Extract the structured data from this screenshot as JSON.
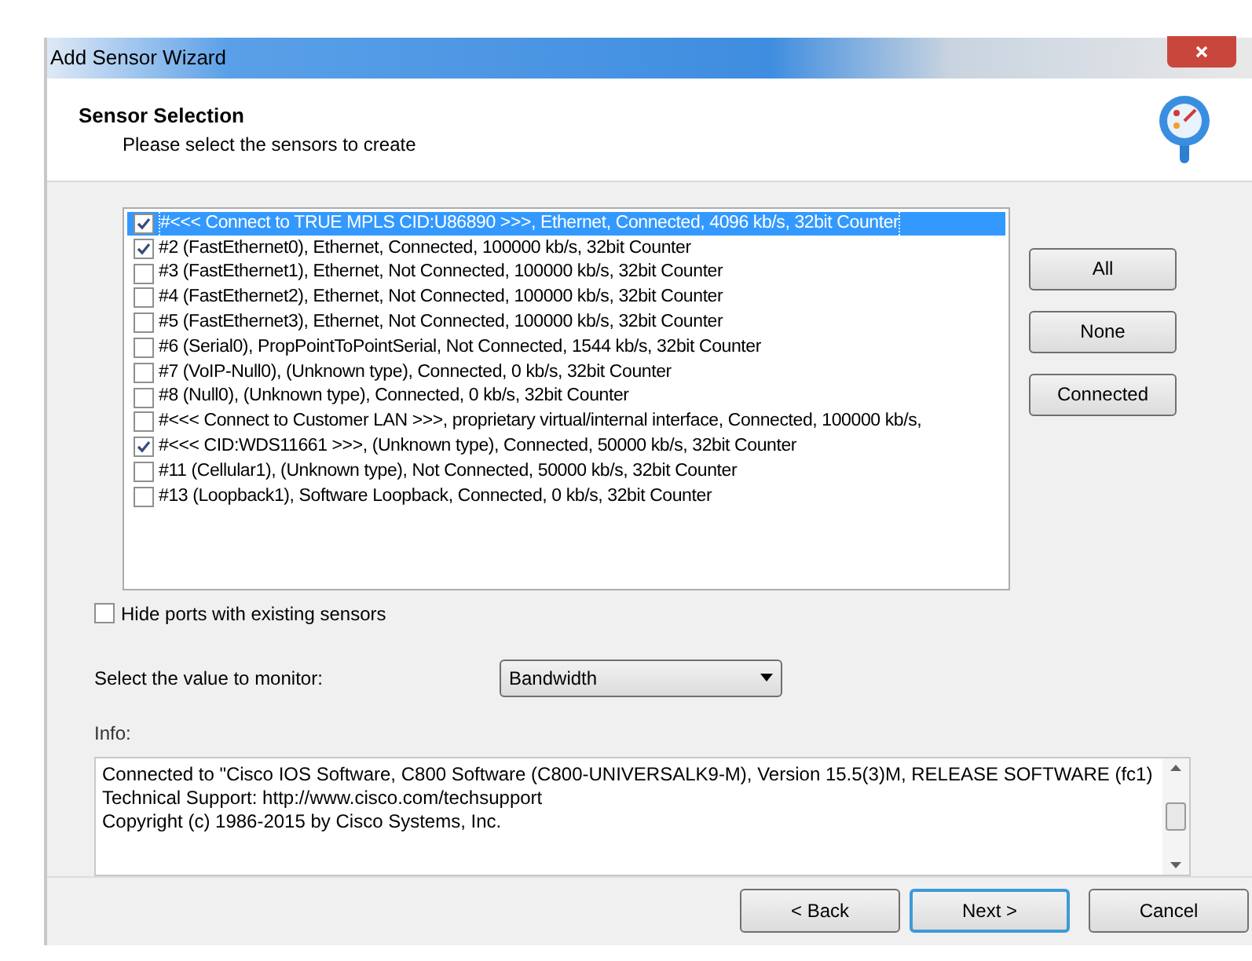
{
  "window": {
    "title": "Add Sensor Wizard"
  },
  "header": {
    "title": "Sensor Selection",
    "subtitle": "Please select the sensors to create"
  },
  "sensors": [
    {
      "label": "#<<< Connect to TRUE MPLS CID:U86890 >>>, Ethernet, Connected, 4096 kb/s, 32bit Counter",
      "checked": true,
      "selected": true
    },
    {
      "label": "#2 (FastEthernet0), Ethernet, Connected, 100000 kb/s, 32bit Counter",
      "checked": true,
      "selected": false
    },
    {
      "label": "#3 (FastEthernet1), Ethernet, Not Connected, 100000 kb/s, 32bit Counter",
      "checked": false,
      "selected": false
    },
    {
      "label": "#4 (FastEthernet2), Ethernet, Not Connected, 100000 kb/s, 32bit Counter",
      "checked": false,
      "selected": false
    },
    {
      "label": "#5 (FastEthernet3), Ethernet, Not Connected, 100000 kb/s, 32bit Counter",
      "checked": false,
      "selected": false
    },
    {
      "label": "#6 (Serial0), PropPointToPointSerial, Not Connected, 1544 kb/s, 32bit Counter",
      "checked": false,
      "selected": false
    },
    {
      "label": "#7 (VoIP-Null0), (Unknown type), Connected, 0 kb/s, 32bit Counter",
      "checked": false,
      "selected": false
    },
    {
      "label": "#8 (Null0), (Unknown type), Connected, 0 kb/s, 32bit Counter",
      "checked": false,
      "selected": false
    },
    {
      "label": "#<<< Connect to Customer LAN >>>, proprietary virtual/internal interface, Connected, 100000 kb/s,",
      "checked": false,
      "selected": false
    },
    {
      "label": "#<<< CID:WDS11661 >>>, (Unknown type), Connected, 50000 kb/s, 32bit Counter",
      "checked": true,
      "selected": false
    },
    {
      "label": "#11 (Cellular1), (Unknown type), Not Connected, 50000 kb/s, 32bit Counter",
      "checked": false,
      "selected": false
    },
    {
      "label": "#13 (Loopback1), Software Loopback, Connected, 0 kb/s, 32bit Counter",
      "checked": false,
      "selected": false
    }
  ],
  "side_buttons": [
    "All",
    "None",
    "Connected"
  ],
  "hide_ports": {
    "label": "Hide ports with existing sensors",
    "checked": false
  },
  "monitor": {
    "label": "Select the value to monitor:",
    "value": "Bandwidth"
  },
  "info": {
    "label": "Info:",
    "lines": [
      "Connected to \"Cisco IOS Software, C800 Software (C800-UNIVERSALK9-M), Version 15.5(3)M, RELEASE SOFTWARE (fc1)",
      "Technical Support: http://www.cisco.com/techsupport",
      "Copyright (c) 1986-2015 by Cisco Systems, Inc."
    ]
  },
  "footer_buttons": [
    "< Back",
    "Next >",
    "Cancel"
  ]
}
